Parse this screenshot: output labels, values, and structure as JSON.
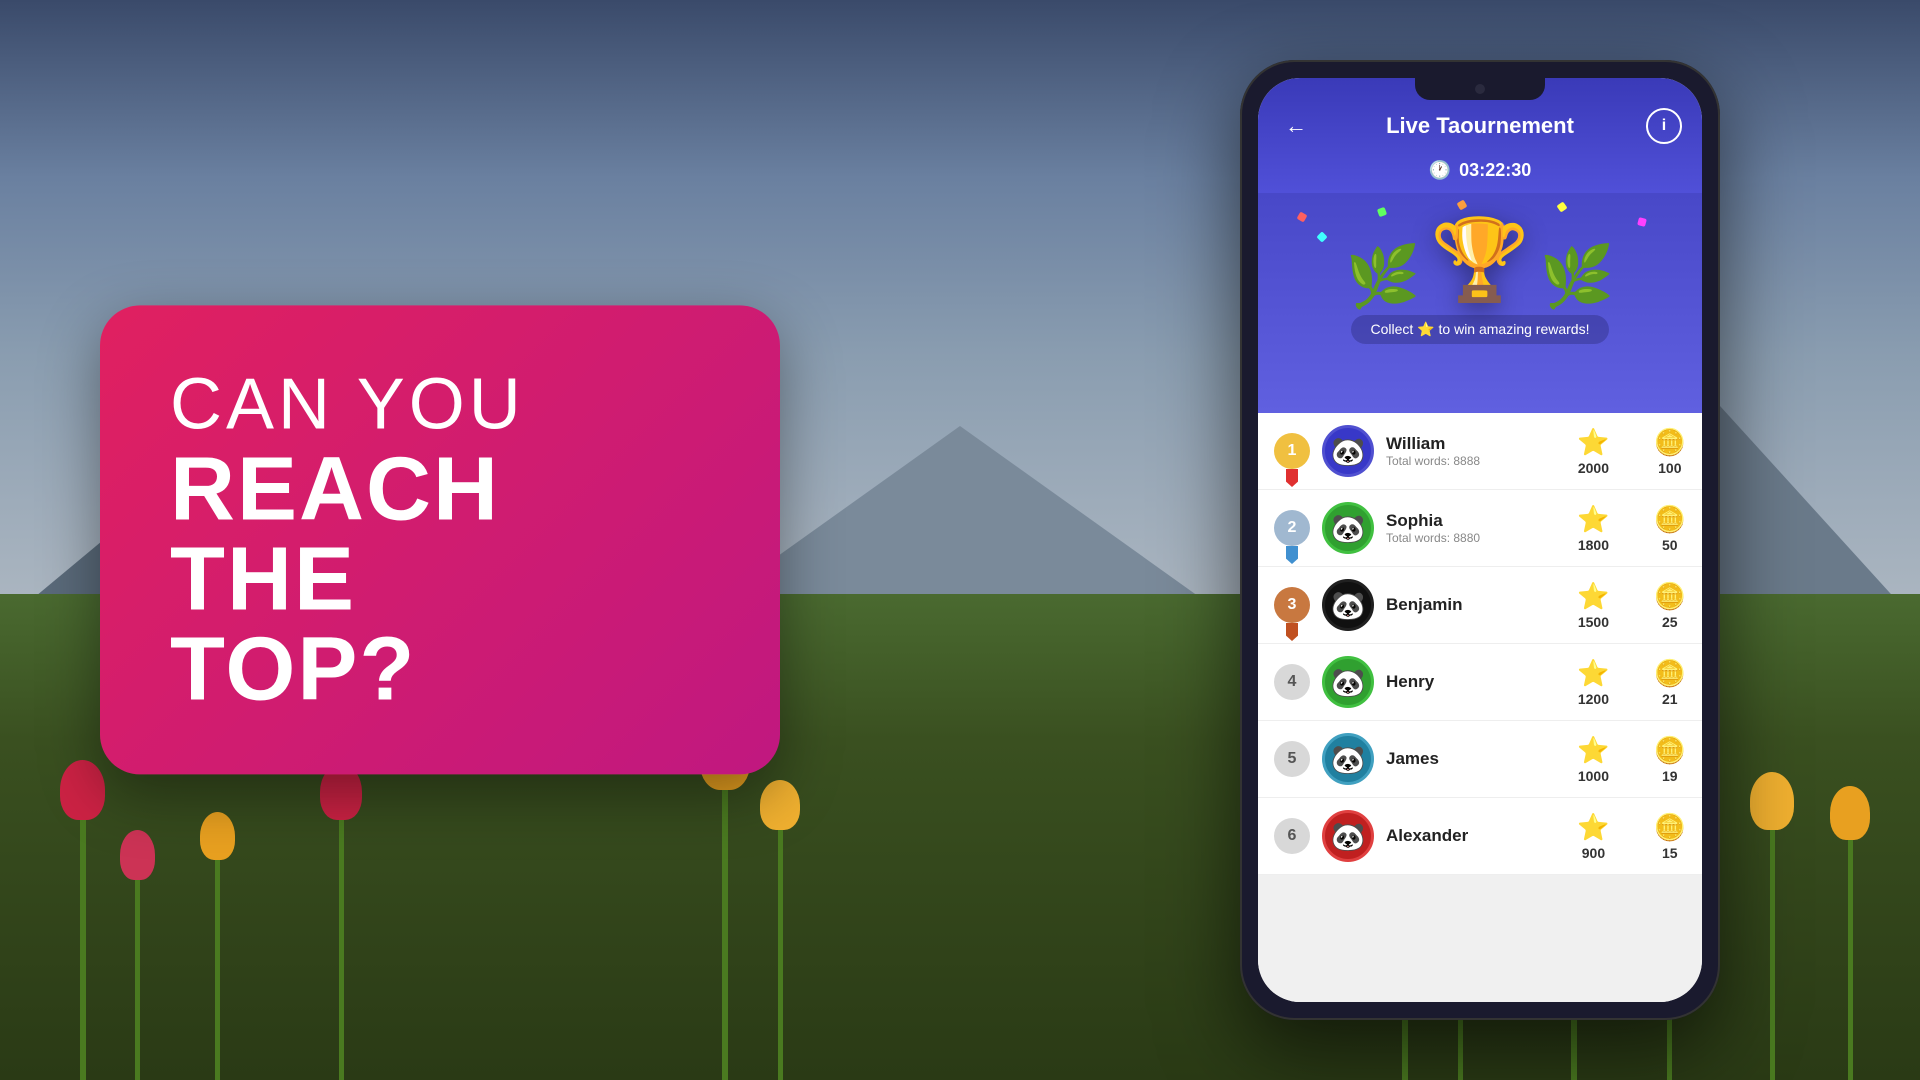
{
  "background": {
    "description": "Tulip field with mountains and cloudy sky"
  },
  "promo": {
    "line1": "CAN YOU",
    "line2": "REACH THE",
    "line3": "TOP?"
  },
  "app": {
    "title": "Live Taournement",
    "timer": "03:22:30",
    "collect_text": "Collect ⭐ to win amazing rewards!",
    "back_label": "←",
    "info_label": "i",
    "players": [
      {
        "rank": 1,
        "name": "William",
        "words": "Total words: 8888",
        "stars": 2000,
        "coins": 100,
        "avatar_color": "#3838c8",
        "border_color": "#5050d0"
      },
      {
        "rank": 2,
        "name": "Sophia",
        "words": "Total words: 8880",
        "stars": 1800,
        "coins": 50,
        "avatar_color": "#30a030",
        "border_color": "#40c040"
      },
      {
        "rank": 3,
        "name": "Benjamin",
        "words": "",
        "stars": 1500,
        "coins": 25,
        "avatar_color": "#101010",
        "border_color": "#202020"
      },
      {
        "rank": 4,
        "name": "Henry",
        "words": "",
        "stars": 1200,
        "coins": 21,
        "avatar_color": "#30a030",
        "border_color": "#40c040"
      },
      {
        "rank": 5,
        "name": "James",
        "words": "",
        "stars": 1000,
        "coins": 19,
        "avatar_color": "#2080a0",
        "border_color": "#40a0c0"
      },
      {
        "rank": 6,
        "name": "Alexander",
        "words": "",
        "stars": 900,
        "coins": 15,
        "avatar_color": "#c02020",
        "border_color": "#e04040"
      }
    ]
  }
}
